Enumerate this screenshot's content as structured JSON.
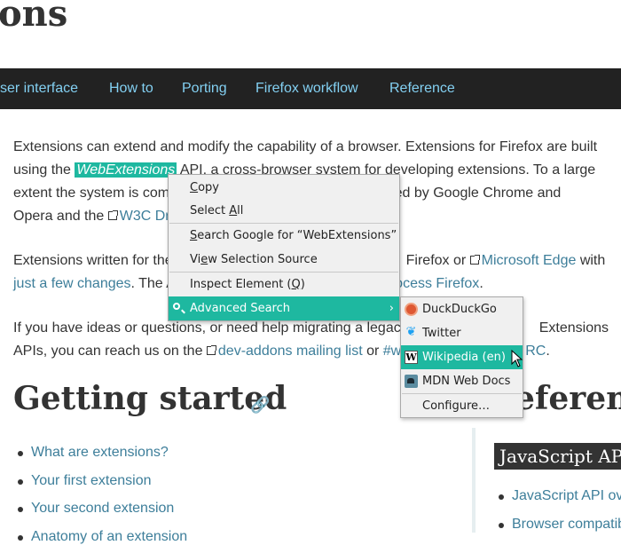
{
  "page": {
    "title": "ons"
  },
  "nav": {
    "items": [
      "ser interface",
      "How to",
      "Porting",
      "Firefox workflow",
      "Reference"
    ]
  },
  "intro": {
    "p1": {
      "line1": "Extensions can extend and modify the capability of a browser. Extensions for Firefox are built",
      "l2_pre": "using the ",
      "l2_hl": "WebExtensions",
      "l2_post": " API, a cross-browser system for developing extensions. To a large",
      "l3_pre": "extent the system is comp",
      "l3_post": "orted by Google Chrome and",
      "l4_pre": "Opera and the ",
      "l4_link": "W3C Dr"
    },
    "p2": {
      "l1_pre": "Extensions written for the",
      "l1_mid": "Firefox or ",
      "l1_link": "Microsoft Edge",
      "l1_post": " with",
      "l2_link": "just a few changes",
      "l2_mid": ". The A",
      "l2_link2": "process Firefox",
      "l2_post": "."
    },
    "p3": {
      "l1_pre": "If you have ideas or questions, or need help migrating a legacy",
      "l1_post": "Extensions",
      "l2_pre": "APIs, you can reach us on the ",
      "l2_link": "dev-addons mailing list",
      "l2_mid": " or ",
      "l2_link2": "#w",
      "l2_link3": "RC",
      "l2_post": "."
    }
  },
  "getting_started": {
    "heading": "Getting started",
    "items": [
      "What are extensions?",
      "Your first extension",
      "Your second extension",
      "Anatomy of an extension"
    ]
  },
  "reference": {
    "heading": "eferenc",
    "pill": "JavaScript AP",
    "items": [
      "JavaScript API ov",
      "Browser compatib"
    ]
  },
  "context_menu": {
    "items": [
      {
        "pre": "",
        "u": "C",
        "post": "opy"
      },
      {
        "pre": "Select ",
        "u": "A",
        "post": "ll"
      },
      {
        "pre": "",
        "u": "S",
        "post": "earch Google for “WebExtensions”"
      },
      {
        "pre": "Vi",
        "u": "e",
        "post": "w Selection Source"
      },
      {
        "pre": "Inspect Element (",
        "u": "Q",
        "post": ")"
      },
      {
        "pre": "Advanced Search",
        "u": "",
        "post": ""
      }
    ],
    "chevron": "›"
  },
  "submenu": {
    "items": [
      "DuckDuckGo",
      "Twitter",
      "Wikipedia (en)",
      "MDN Web Docs",
      "Configure…"
    ],
    "wiki_glyph": "W",
    "twitter_glyph": "❦"
  },
  "colors": {
    "accent": "#1eb8a0",
    "nav_bg": "#222222",
    "nav_link": "#83d0f2",
    "link": "#3d7e9a"
  }
}
